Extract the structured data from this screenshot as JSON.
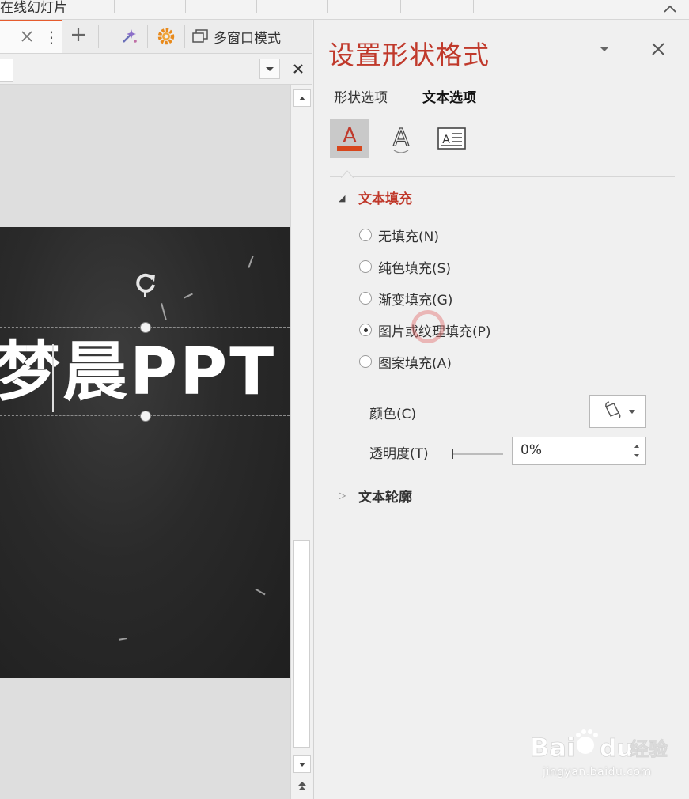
{
  "ribbon": {
    "title": "在线幻灯片"
  },
  "tabs": {
    "multi_window_label": "多窗口模式"
  },
  "slide": {
    "title_text": "梦晨PPT"
  },
  "pane": {
    "title": "设置形状格式",
    "tab_shape_options": "形状选项",
    "tab_text_options": "文本选项",
    "section_text_fill": "文本填充",
    "fill_options": [
      {
        "label": "无填充(N)",
        "selected": false
      },
      {
        "label": "纯色填充(S)",
        "selected": false
      },
      {
        "label": "渐变填充(G)",
        "selected": false
      },
      {
        "label": "图片或纹理填充(P)",
        "selected": true
      },
      {
        "label": "图案填充(A)",
        "selected": false
      }
    ],
    "color_label": "颜色(C)",
    "transparency_label": "透明度(T)",
    "transparency_value": "0%",
    "section_text_outline": "文本轮廓"
  },
  "watermark": {
    "brand": "Bai du 经验",
    "url": "jingyan.baidu.com"
  },
  "colors": {
    "accent": "#c0392b",
    "tab_accent": "#e65c2e"
  }
}
